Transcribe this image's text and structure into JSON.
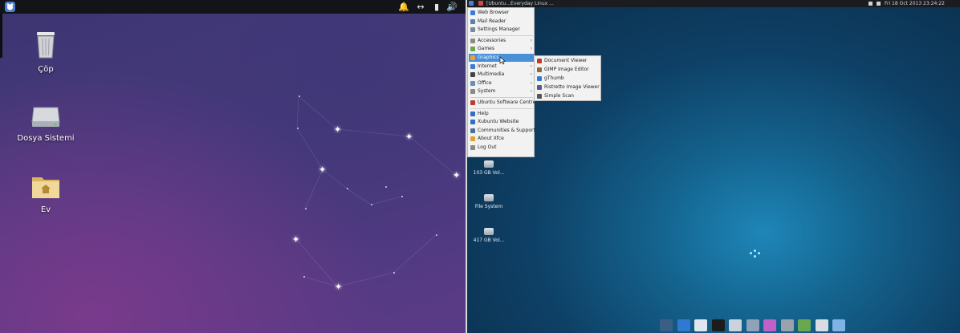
{
  "left_panel": {
    "top_bar": {
      "tray_icons": [
        "bell-icon",
        "network-icon",
        "battery-icon",
        "volume-icon"
      ],
      "tray_glyphs": [
        "🔔",
        "↔",
        "▮",
        "🔊"
      ]
    },
    "desktop_icons": [
      {
        "name": "trash-icon",
        "label": "Çöp"
      },
      {
        "name": "drive-icon",
        "label": "Dosya Sistemi"
      },
      {
        "name": "home-folder-icon",
        "label": "Ev"
      }
    ],
    "colors": {
      "background": "#4a3a7e",
      "accent": "#7a3a8c",
      "panel": "#131417"
    }
  },
  "right_panel": {
    "top_bar": {
      "window_title": "[Ubuntu...Everyday Linux ...",
      "clock": "Fri 18 Oct 2013 23:24:22"
    },
    "menu": {
      "items": [
        {
          "label": "Web Browser",
          "icon": "globe-icon",
          "arrow": ""
        },
        {
          "label": "Mail Reader",
          "icon": "mail-icon",
          "arrow": ""
        },
        {
          "label": "Settings Manager",
          "icon": "settings-icon",
          "arrow": ""
        },
        {
          "label": "Accessories",
          "icon": "accessories-icon",
          "arrow": "›"
        },
        {
          "label": "Games",
          "icon": "games-icon",
          "arrow": "›"
        },
        {
          "label": "Graphics",
          "icon": "graphics-icon",
          "arrow": "›"
        },
        {
          "label": "Internet",
          "icon": "internet-icon",
          "arrow": "›"
        },
        {
          "label": "Multimedia",
          "icon": "multimedia-icon",
          "arrow": "›"
        },
        {
          "label": "Office",
          "icon": "office-icon",
          "arrow": "›"
        },
        {
          "label": "System",
          "icon": "system-icon",
          "arrow": "›"
        },
        {
          "label": "Ubuntu Software Centre",
          "icon": "software-centre-icon",
          "arrow": ""
        },
        {
          "label": "Help",
          "icon": "help-icon",
          "arrow": ""
        },
        {
          "label": "Xubuntu Website",
          "icon": "website-icon",
          "arrow": ""
        },
        {
          "label": "Communities & Support",
          "icon": "community-icon",
          "arrow": ""
        },
        {
          "label": "About Xfce",
          "icon": "about-icon",
          "arrow": ""
        },
        {
          "label": "Log Out",
          "icon": "logout-icon",
          "arrow": ""
        }
      ],
      "selected_label": "Graphics"
    },
    "submenu": {
      "items": [
        {
          "label": "Document Viewer",
          "icon": "document-viewer-icon"
        },
        {
          "label": "GIMP Image Editor",
          "icon": "gimp-icon"
        },
        {
          "label": "gThumb",
          "icon": "gthumb-icon"
        },
        {
          "label": "Ristretto Image Viewer",
          "icon": "ristretto-icon"
        },
        {
          "label": "Simple Scan",
          "icon": "scanner-icon"
        }
      ]
    },
    "desktop_icons": [
      {
        "name": "volume-drive-icon",
        "label": "103 GB Vol..."
      },
      {
        "name": "filesystem-drive-icon",
        "label": "File System"
      },
      {
        "name": "volume-drive-icon",
        "label": "417 GB Vol..."
      }
    ],
    "dock": [
      {
        "name": "show-desktop-icon",
        "color": "#3a5f86"
      },
      {
        "name": "web-browser-icon",
        "color": "#2f7ad0"
      },
      {
        "name": "mail-client-icon",
        "color": "#dfe6ee"
      },
      {
        "name": "terminal-icon",
        "color": "#1c1c1c"
      },
      {
        "name": "file-manager-icon",
        "color": "#c9d3de"
      },
      {
        "name": "search-icon",
        "color": "#8ea3b8"
      },
      {
        "name": "download-icon",
        "color": "#c060c8"
      },
      {
        "name": "text-editor-icon",
        "color": "#9aa3ac"
      },
      {
        "name": "media-player-icon",
        "color": "#6aa84f"
      },
      {
        "name": "image-viewer-icon",
        "color": "#d7dde3"
      },
      {
        "name": "folder-icon",
        "color": "#7fb2e5"
      }
    ],
    "colors": {
      "background": "#14648f",
      "menu_selected": "#4a90d9"
    }
  }
}
